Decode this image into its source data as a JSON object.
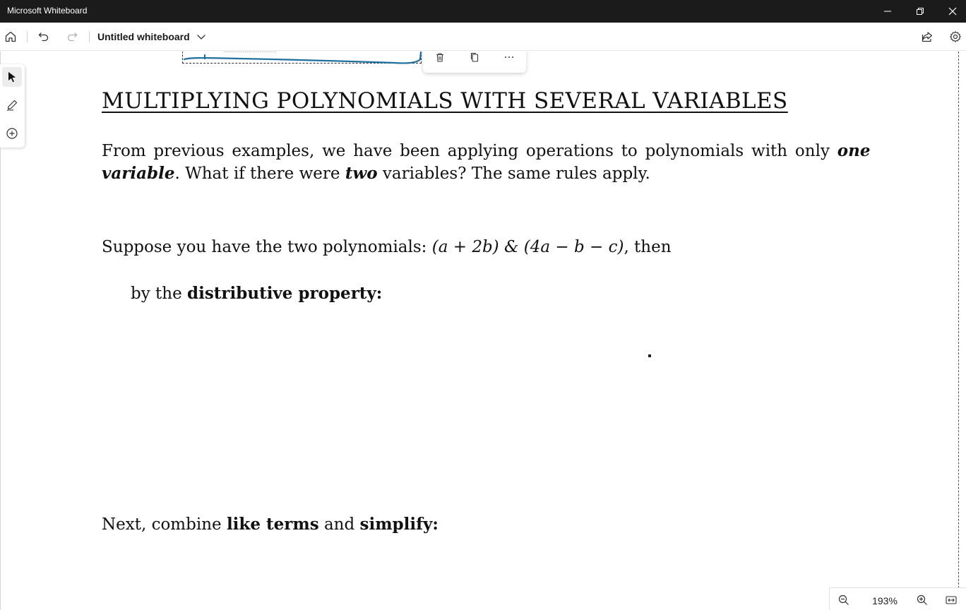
{
  "window": {
    "title": "Microsoft Whiteboard"
  },
  "toolbar": {
    "board_title": "Untitled whiteboard"
  },
  "document": {
    "heading": "MULTIPLYING POLYNOMIALS WITH SEVERAL VARIABLES",
    "para1": {
      "t1": "From previous examples, we have been applying operations to polynomials with only ",
      "t2": "one",
      "t3": "variable",
      "t4": ". What if there were ",
      "t5": "two",
      "t6": " variables? The same rules apply."
    },
    "para2": {
      "t1": "Suppose you have the two polynomials: ",
      "t2": "(a + 2b) & (4a − b − c)",
      "t3": ", then"
    },
    "para3": {
      "t1": "by the ",
      "t2": "distributive property:"
    },
    "para4": {
      "t1": "Next, combine ",
      "t2": "like terms",
      "t3": " and ",
      "t4": "simplify:"
    }
  },
  "zoom": {
    "level": "193%"
  },
  "colors": {
    "titlebar": "#1b1b1b",
    "ink_stroke": "#1f6f9f"
  }
}
